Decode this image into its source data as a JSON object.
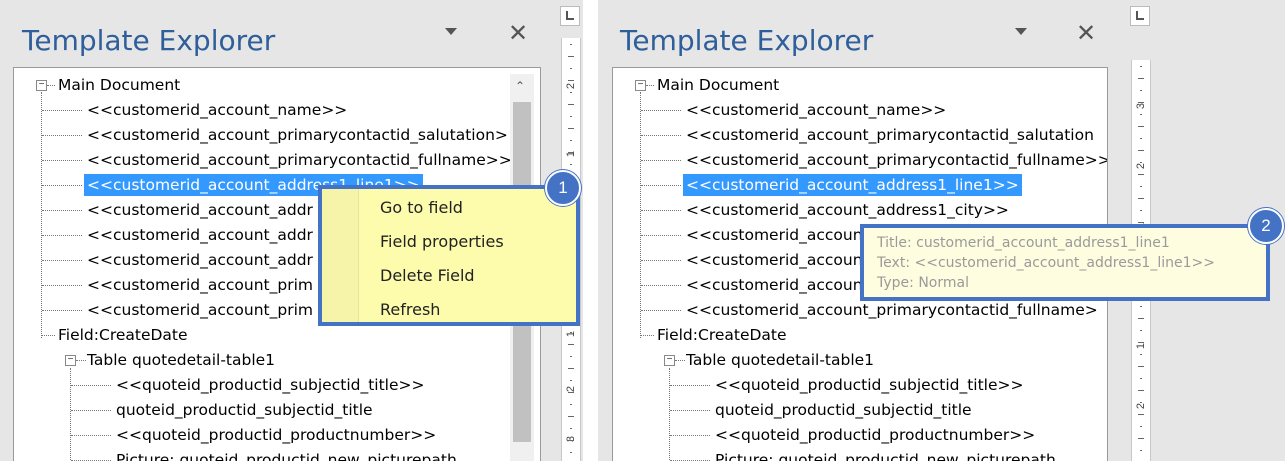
{
  "left": {
    "title": "Template Explorer",
    "tree": [
      "Main Document",
      "<<customerid_account_name>>",
      "<<customerid_account_primarycontactid_salutation>",
      "<<customerid_account_primarycontactid_fullname>>",
      "<<customerid_account_address1_line1>>",
      "<<customerid_account_addr",
      "<<customerid_account_addr",
      "<<customerid_account_addr",
      "<<customerid_account_prim",
      "<<customerid_account_prim",
      "Field:CreateDate",
      "Table quotedetail-table1",
      "<<quoteid_productid_subjectid_title>>",
      "quoteid_productid_subjectid_title",
      "<<quoteid_productid_productnumber>>",
      "Picture: quoteid_productid_new_picturepath"
    ],
    "context_menu": [
      "Go to field",
      "Field properties",
      "Delete Field",
      "Refresh"
    ],
    "badge": "1",
    "ruler_numbers": [
      "2",
      "1",
      "1",
      "2",
      "3",
      "4"
    ]
  },
  "right": {
    "title": "Template Explorer",
    "tree": [
      "Main Document",
      "<<customerid_account_name>>",
      "<<customerid_account_primarycontactid_salutation",
      "<<customerid_account_primarycontactid_fullname>>",
      "<<customerid_account_address1_line1>>",
      "<<customerid_account_address1_city>>",
      "<<customerid_account",
      "<<customerid_account",
      "<<customerid_account",
      "<<customerid_account_primarycontactid_fullname>",
      "Field:CreateDate",
      "Table quotedetail-table1",
      "<<quoteid_productid_subjectid_title>>",
      "quoteid_productid_subjectid_title",
      "<<quoteid_productid_productnumber>>",
      "Picture: quoteid_productid_new_picturepath"
    ],
    "tooltip": {
      "title": "Title: customerid_account_address1_line1",
      "text": "Text: <<customerid_account_address1_line1>>",
      "type": "Type: Normal"
    },
    "badge": "2",
    "ruler_numbers": [
      "3",
      "2",
      "1",
      "1",
      "2"
    ]
  },
  "colors": {
    "selection": "#3399ff",
    "accent": "#4472c4",
    "title": "#2e5f9a",
    "menu_bg": "#fdfcad",
    "tooltip_bg": "#fffde0"
  }
}
